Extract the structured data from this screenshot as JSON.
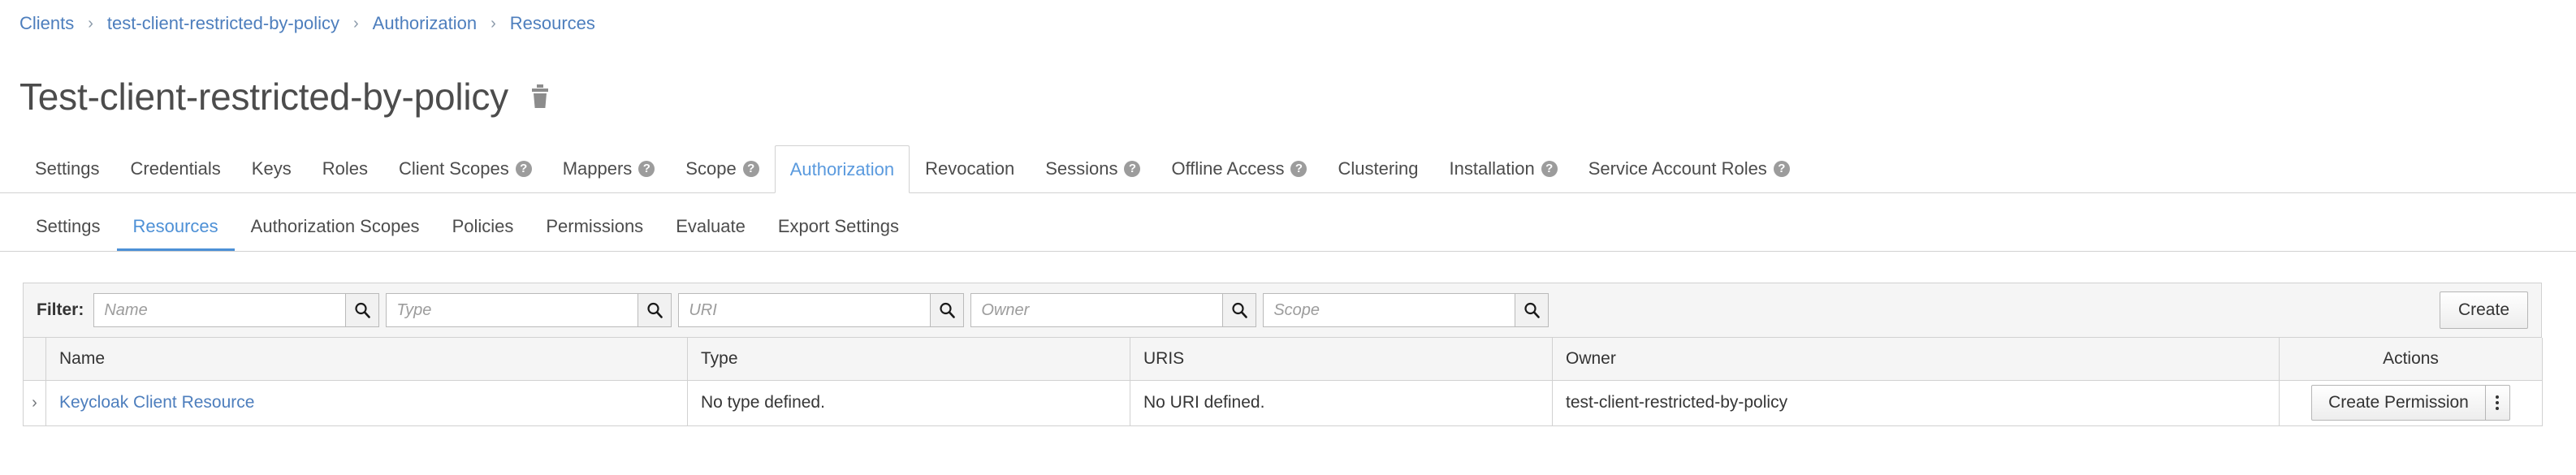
{
  "breadcrumb": {
    "separator": "›",
    "items": [
      {
        "label": "Clients"
      },
      {
        "label": "test-client-restricted-by-policy"
      },
      {
        "label": "Authorization"
      },
      {
        "label": "Resources"
      }
    ]
  },
  "header": {
    "title": "Test-client-restricted-by-policy",
    "delete_icon": "trash-icon"
  },
  "primary_tabs": [
    {
      "label": "Settings",
      "help": false,
      "active": false
    },
    {
      "label": "Credentials",
      "help": false,
      "active": false
    },
    {
      "label": "Keys",
      "help": false,
      "active": false
    },
    {
      "label": "Roles",
      "help": false,
      "active": false
    },
    {
      "label": "Client Scopes",
      "help": true,
      "active": false
    },
    {
      "label": "Mappers",
      "help": true,
      "active": false
    },
    {
      "label": "Scope",
      "help": true,
      "active": false
    },
    {
      "label": "Authorization",
      "help": false,
      "active": true
    },
    {
      "label": "Revocation",
      "help": false,
      "active": false
    },
    {
      "label": "Sessions",
      "help": true,
      "active": false
    },
    {
      "label": "Offline Access",
      "help": true,
      "active": false
    },
    {
      "label": "Clustering",
      "help": false,
      "active": false
    },
    {
      "label": "Installation",
      "help": true,
      "active": false
    },
    {
      "label": "Service Account Roles",
      "help": true,
      "active": false
    }
  ],
  "help_glyph": "?",
  "secondary_tabs": [
    {
      "label": "Settings",
      "active": false
    },
    {
      "label": "Resources",
      "active": true
    },
    {
      "label": "Authorization Scopes",
      "active": false
    },
    {
      "label": "Policies",
      "active": false
    },
    {
      "label": "Permissions",
      "active": false
    },
    {
      "label": "Evaluate",
      "active": false
    },
    {
      "label": "Export Settings",
      "active": false
    }
  ],
  "toolbar": {
    "filter_label": "Filter:",
    "filters": [
      {
        "name": "name",
        "placeholder": "Name",
        "value": ""
      },
      {
        "name": "type",
        "placeholder": "Type",
        "value": ""
      },
      {
        "name": "uri",
        "placeholder": "URI",
        "value": ""
      },
      {
        "name": "owner",
        "placeholder": "Owner",
        "value": ""
      },
      {
        "name": "scope",
        "placeholder": "Scope",
        "value": ""
      }
    ],
    "search_icon": "search-icon",
    "create_label": "Create"
  },
  "table": {
    "columns": [
      "Name",
      "Type",
      "URIS",
      "Owner",
      "Actions"
    ],
    "rows": [
      {
        "toggle": "›",
        "name": "Keycloak Client Resource",
        "type": "No type defined.",
        "uris": "No URI defined.",
        "owner": "test-client-restricted-by-policy",
        "action_label": "Create Permission",
        "kebab": "kebab-menu-icon"
      }
    ]
  },
  "colors": {
    "link": "#4d7ebd",
    "active_tab": "#4d90d6",
    "border": "#d1d1d1",
    "toolbar_bg": "#f5f5f5",
    "help_badge": "#9c9c9c"
  }
}
